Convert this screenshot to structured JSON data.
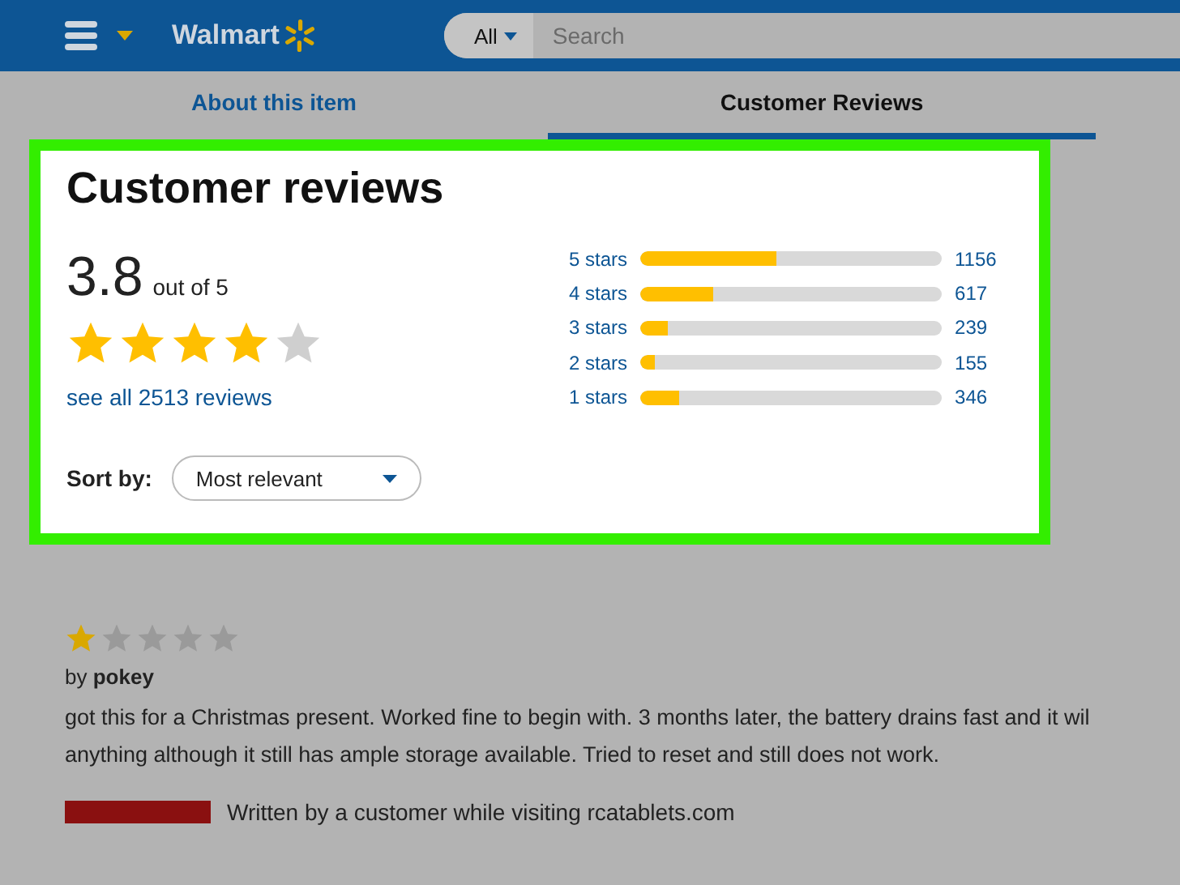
{
  "header": {
    "brand": "Walmart",
    "search_scope": "All",
    "search": {
      "placeholder": "Search"
    }
  },
  "tabs": [
    {
      "label": "About this item",
      "selected": false
    },
    {
      "label": "Customer Reviews",
      "selected": true
    }
  ],
  "reviews_panel": {
    "title": "Customer reviews",
    "rating": "3.8",
    "rating_suffix": "out of 5",
    "stars": 4,
    "see_all": "see all 2513 reviews",
    "sort_label": "Sort by:",
    "sort_value": "Most relevant",
    "breakdown": [
      {
        "label": "5 stars",
        "level": 0.45,
        "count": "1156"
      },
      {
        "label": "4 stars",
        "level": 0.24,
        "count": "617"
      },
      {
        "label": "3 stars",
        "level": 0.09,
        "count": "239"
      },
      {
        "label": "2 stars",
        "level": 0.05,
        "count": "155"
      },
      {
        "label": "1 stars",
        "level": 0.13,
        "count": "346"
      }
    ]
  },
  "review": {
    "stars": 1,
    "by": "by",
    "author": "pokey",
    "lines": [
      "got this for a Christmas present. Worked fine to begin with. 3 months later, the battery drains fast and it wil",
      "anything although it still has ample storage available. Tried to reset and still does not work."
    ],
    "source": "Written by a customer while visiting rcatablets.com"
  }
}
